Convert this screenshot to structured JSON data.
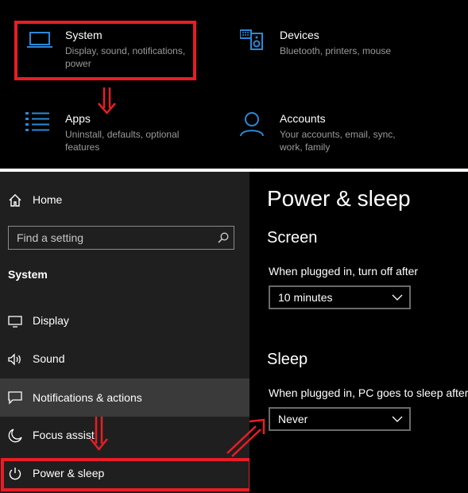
{
  "settings_grid": {
    "tiles": [
      {
        "title": "System",
        "subtitle": "Display, sound, notifications, power",
        "icon": "laptop-icon"
      },
      {
        "title": "Devices",
        "subtitle": "Bluetooth, printers, mouse",
        "icon": "devices-icon"
      },
      {
        "title": "Apps",
        "subtitle": "Uninstall, defaults, optional features",
        "icon": "apps-list-icon"
      },
      {
        "title": "Accounts",
        "subtitle": "Your accounts, email, sync, work, family",
        "icon": "person-icon"
      }
    ]
  },
  "sidebar": {
    "home_label": "Home",
    "search_placeholder": "Find a setting",
    "section_title": "System",
    "items": [
      {
        "label": "Display",
        "icon": "monitor-icon"
      },
      {
        "label": "Sound",
        "icon": "speaker-icon"
      },
      {
        "label": "Notifications & actions",
        "icon": "notification-icon"
      },
      {
        "label": "Focus assist",
        "icon": "moon-icon"
      },
      {
        "label": "Power & sleep",
        "icon": "power-icon"
      }
    ]
  },
  "main": {
    "page_title": "Power & sleep",
    "screen": {
      "heading": "Screen",
      "label": "When plugged in, turn off after",
      "value": "10 minutes"
    },
    "sleep": {
      "heading": "Sleep",
      "label": "When plugged in, PC goes to sleep after",
      "value": "Never"
    }
  },
  "colors": {
    "accent": "#2b88d8",
    "annotation": "#e81d25",
    "sidebar_bg": "#1f1f1f",
    "hover_bg": "#3a3a3a"
  }
}
